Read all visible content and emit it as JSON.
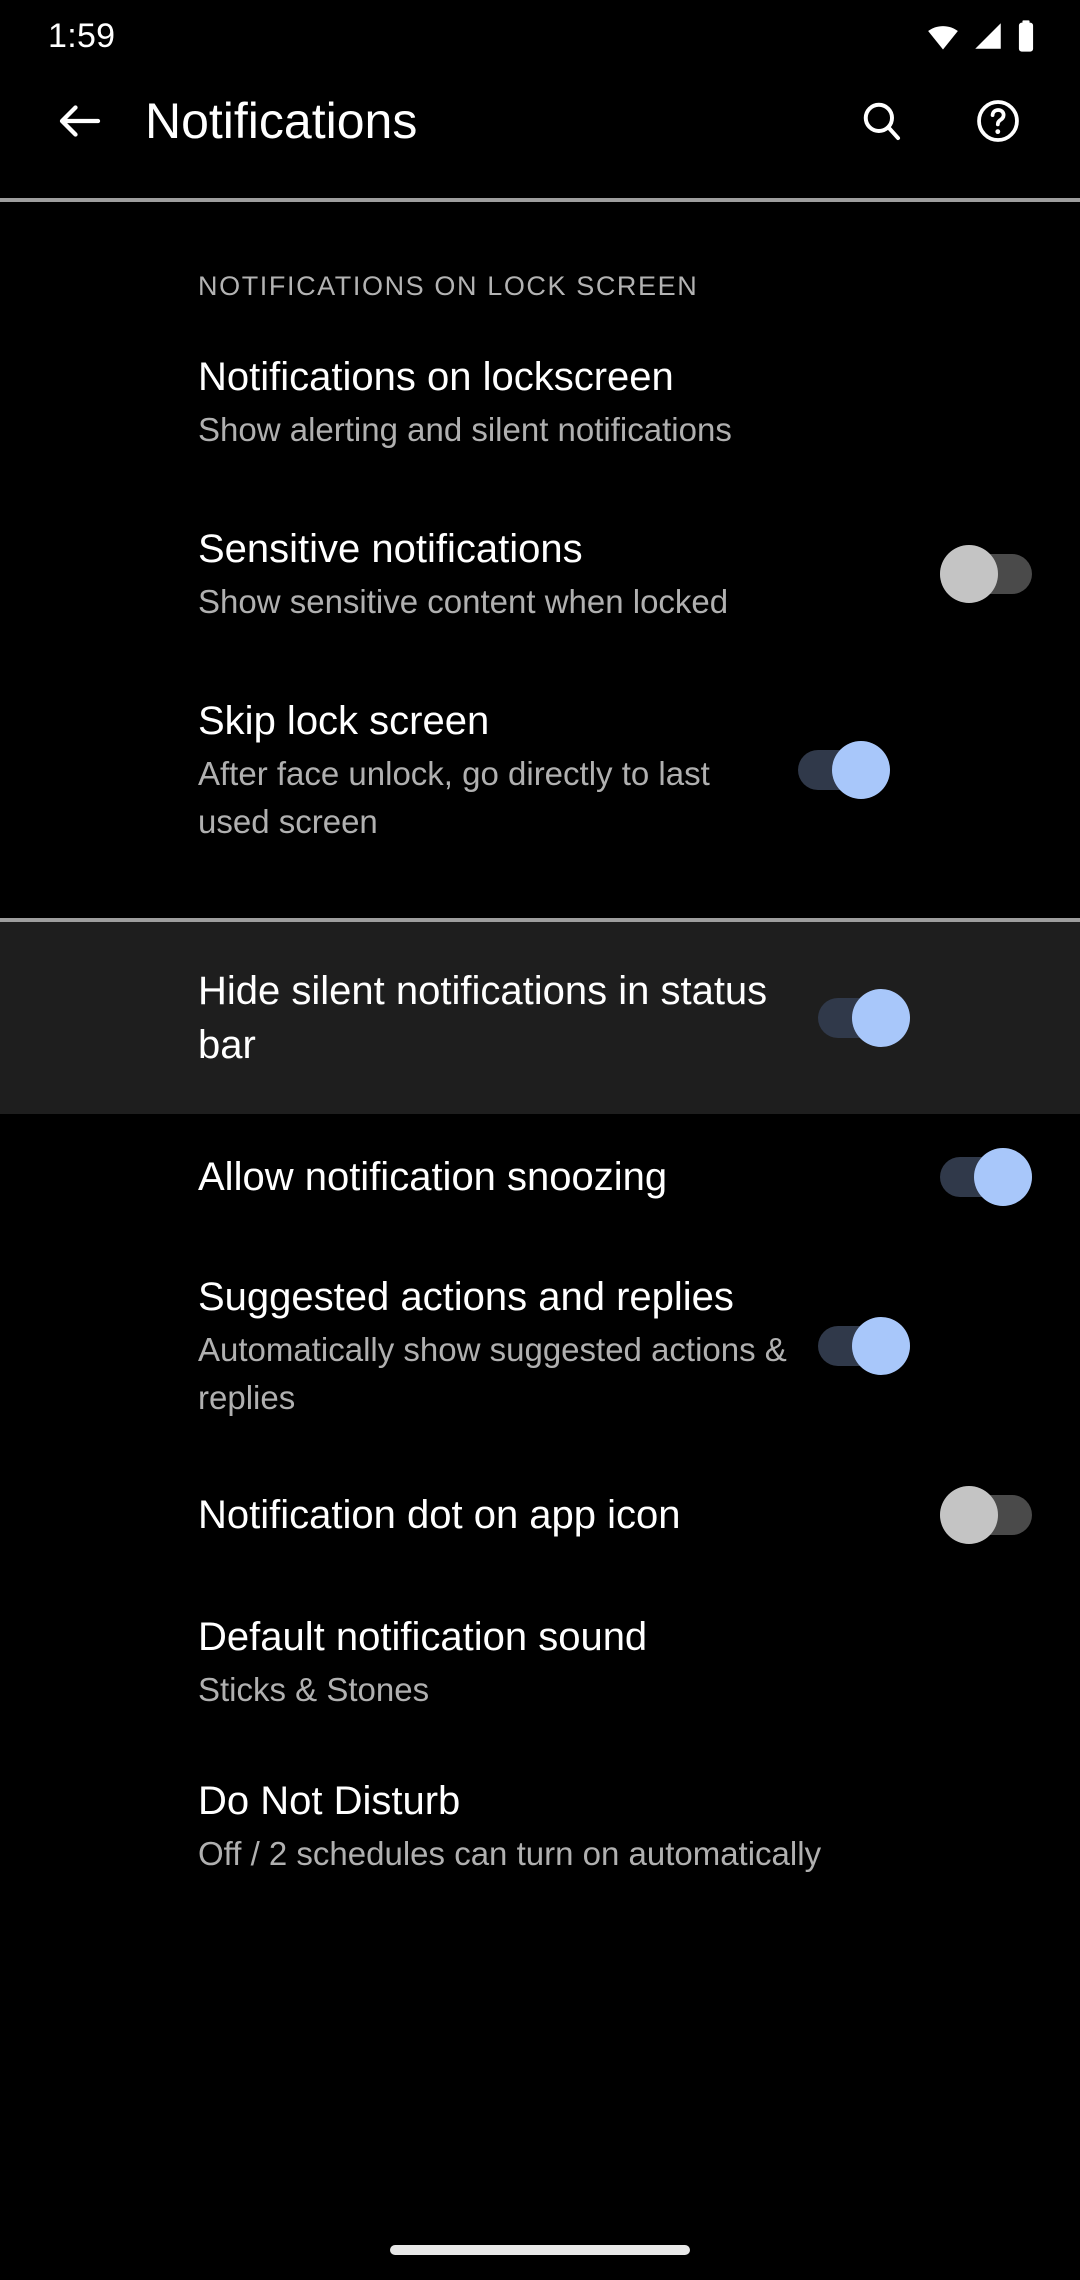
{
  "status_bar": {
    "time": "1:59",
    "icons": [
      "wifi-icon",
      "cellular-signal-icon",
      "battery-icon"
    ]
  },
  "app_bar": {
    "back_icon": "back-arrow-icon",
    "title": "Notifications",
    "search_icon": "search-icon",
    "help_icon": "help-circle-icon"
  },
  "sections": [
    {
      "header": "NOTIFICATIONS ON LOCK SCREEN",
      "items": [
        {
          "title": "Notifications on lockscreen",
          "subtitle": "Show alerting and silent notifications",
          "control": "none"
        },
        {
          "title": "Sensitive notifications",
          "subtitle": "Show sensitive content when locked",
          "control": "switch",
          "state": "off"
        },
        {
          "title": "Skip lock screen",
          "subtitle": "After face unlock, go directly to last used screen",
          "control": "switch",
          "state": "on"
        }
      ]
    },
    {
      "header": "",
      "items": [
        {
          "title": "Hide silent notifications in status bar",
          "subtitle": "",
          "control": "switch",
          "state": "on",
          "highlighted": true
        },
        {
          "title": "Allow notification snoozing",
          "subtitle": "",
          "control": "switch",
          "state": "on"
        },
        {
          "title": "Suggested actions and replies",
          "subtitle": "Automatically show suggested actions & replies",
          "control": "switch",
          "state": "on"
        },
        {
          "title": "Notification dot on app icon",
          "subtitle": "",
          "control": "switch",
          "state": "off"
        },
        {
          "title": "Default notification sound",
          "subtitle": "Sticks & Stones",
          "control": "none"
        },
        {
          "title": "Do Not Disturb",
          "subtitle": "Off / 2 schedules can turn on automatically",
          "control": "none"
        }
      ]
    }
  ],
  "nav_bar": {
    "gesture_pill": "home-gesture-pill"
  },
  "colors": {
    "background": "#000000",
    "highlight_row": "#1e1e1e",
    "switch_on_thumb": "#a8c7fa",
    "switch_on_track": "#30394a",
    "switch_off_thumb": "#c4c4c4",
    "switch_off_track": "#4a4a4a",
    "primary_text": "#ffffff",
    "secondary_text": "#b0b0b0",
    "divider": "#9e9e9e"
  }
}
